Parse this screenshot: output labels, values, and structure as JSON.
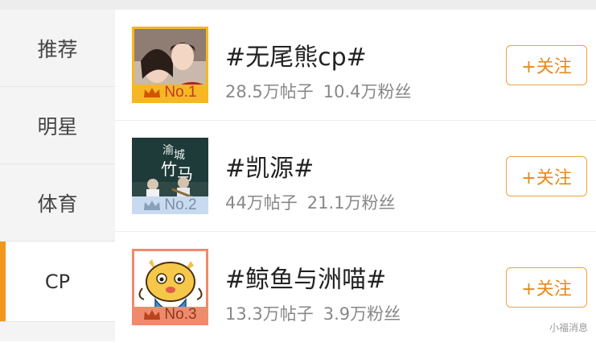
{
  "sidebar": {
    "items": [
      {
        "label": "推荐"
      },
      {
        "label": "明星"
      },
      {
        "label": "体育"
      },
      {
        "label": "CP"
      }
    ],
    "active_index": 3
  },
  "topics": [
    {
      "title": "#无尾熊cp#",
      "posts": "28.5万帖子",
      "fans": "10.4万粉丝",
      "rank": "No.1",
      "badge_color": "#f5b823",
      "badge_text_color": "#c0392b"
    },
    {
      "title": "#凯源#",
      "posts": "44万帖子",
      "fans": "21.1万粉丝",
      "rank": "No.2",
      "badge_color": "#c8daf0",
      "badge_text_color": "#7b8fa6",
      "thumb_text": "渝城 竹马"
    },
    {
      "title": "#鲸鱼与洲喵#",
      "posts": "13.3万帖子",
      "fans": "3.9万粉丝",
      "rank": "No.3",
      "badge_color": "#f08a6c",
      "badge_text_color": "#8e3a1e"
    }
  ],
  "follow_label": "+关注",
  "watermark": "小福消息",
  "colors": {
    "accent": "#f4961e",
    "follow": "#e8891a"
  }
}
